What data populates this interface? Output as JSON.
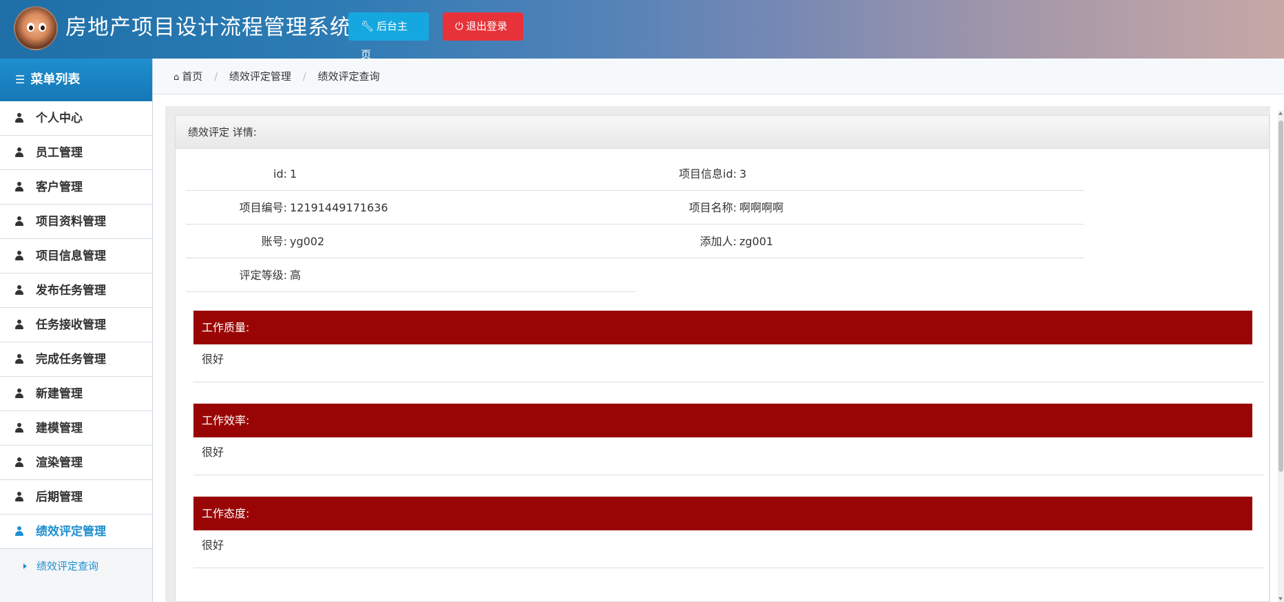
{
  "header": {
    "title": "房地产项目设计流程管理系统",
    "home_button": "后台主页",
    "logout_button": "退出登录",
    "home_icon": "wrench-icon",
    "logout_icon": "power-icon",
    "colors": {
      "home": "#15a8e0",
      "logout": "#e8323a"
    }
  },
  "sidebar": {
    "title": "菜单列表",
    "title_icon": "list-icon",
    "items": [
      {
        "label": "个人中心"
      },
      {
        "label": "员工管理"
      },
      {
        "label": "客户管理"
      },
      {
        "label": "项目资料管理"
      },
      {
        "label": "项目信息管理"
      },
      {
        "label": "发布任务管理"
      },
      {
        "label": "任务接收管理"
      },
      {
        "label": "完成任务管理"
      },
      {
        "label": "新建管理"
      },
      {
        "label": "建模管理"
      },
      {
        "label": "渲染管理"
      },
      {
        "label": "后期管理"
      },
      {
        "label": "绩效评定管理",
        "active": true
      }
    ],
    "submenu": [
      {
        "label": "绩效评定查询"
      }
    ],
    "accent_color": "#1e8fcf"
  },
  "breadcrumb": {
    "items": [
      "首页",
      "绩效评定管理",
      "绩效评定查询"
    ],
    "separator": "/"
  },
  "panel": {
    "title": "绩效评定 详情:",
    "fields": {
      "id": {
        "label": "id:",
        "value": "1"
      },
      "project_info_id": {
        "label": "项目信息id:",
        "value": "3"
      },
      "project_no": {
        "label": "项目编号:",
        "value": "12191449171636"
      },
      "project_name": {
        "label": "项目名称:",
        "value": "啊啊啊啊"
      },
      "account": {
        "label": "账号:",
        "value": "yg002"
      },
      "added_by": {
        "label": "添加人:",
        "value": "zg001"
      },
      "grade": {
        "label": "评定等级:",
        "value": "高"
      }
    },
    "sections": [
      {
        "title": "工作质量:",
        "text": "很好"
      },
      {
        "title": "工作效率:",
        "text": "很好"
      },
      {
        "title": "工作态度:",
        "text": "很好"
      }
    ],
    "section_color": "#990505"
  }
}
